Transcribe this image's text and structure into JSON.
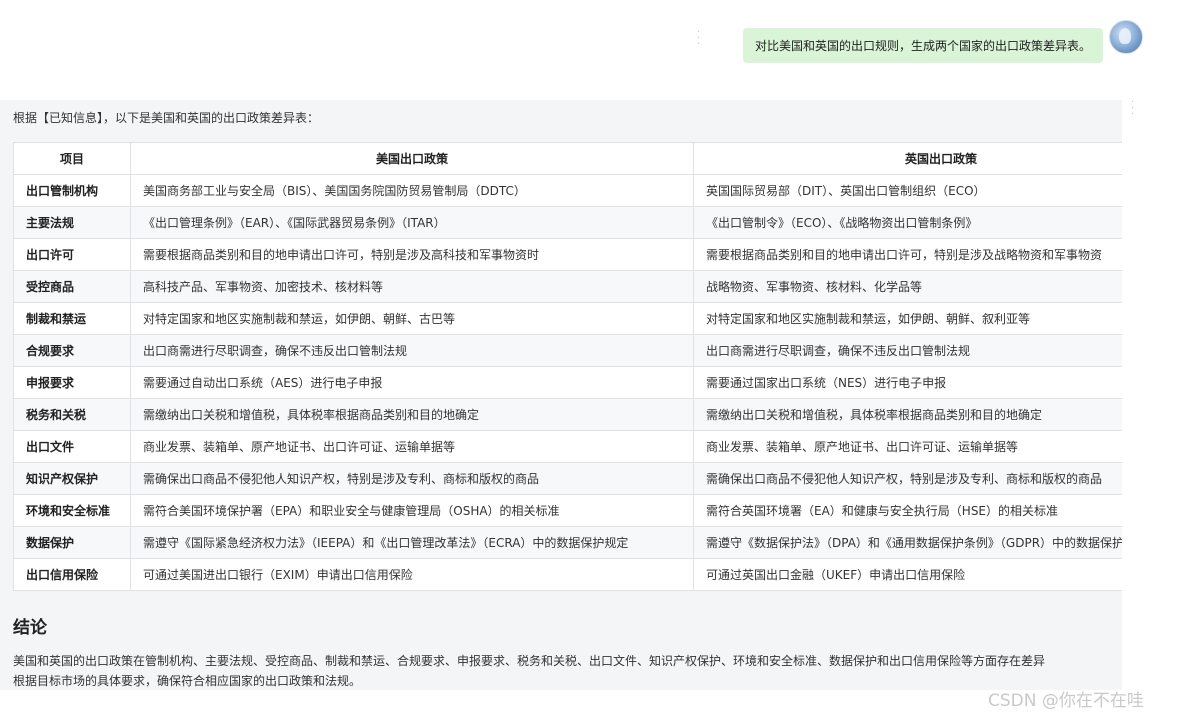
{
  "user_message": {
    "text": "对比美国和英国的出口规则，生成两个国家的出口政策差异表。"
  },
  "assistant": {
    "intro": "根据【已知信息】，以下是美国和英国的出口政策差异表：",
    "table": {
      "headers": [
        "项目",
        "美国出口政策",
        "英国出口政策"
      ],
      "rows": [
        [
          "出口管制机构",
          "美国商务部工业与安全局（BIS）、美国国务院国防贸易管制局（DDTC）",
          "英国国际贸易部（DIT）、英国出口管制组织（ECO）"
        ],
        [
          "主要法规",
          "《出口管理条例》（EAR）、《国际武器贸易条例》（ITAR）",
          "《出口管制令》（ECO）、《战略物资出口管制条例》"
        ],
        [
          "出口许可",
          "需要根据商品类别和目的地申请出口许可，特别是涉及高科技和军事物资时",
          "需要根据商品类别和目的地申请出口许可，特别是涉及战略物资和军事物资"
        ],
        [
          "受控商品",
          "高科技产品、军事物资、加密技术、核材料等",
          "战略物资、军事物资、核材料、化学品等"
        ],
        [
          "制裁和禁运",
          "对特定国家和地区实施制裁和禁运，如伊朗、朝鲜、古巴等",
          "对特定国家和地区实施制裁和禁运，如伊朗、朝鲜、叙利亚等"
        ],
        [
          "合规要求",
          "出口商需进行尽职调查，确保不违反出口管制法规",
          "出口商需进行尽职调查，确保不违反出口管制法规"
        ],
        [
          "申报要求",
          "需要通过自动出口系统（AES）进行电子申报",
          "需要通过国家出口系统（NES）进行电子申报"
        ],
        [
          "税务和关税",
          "需缴纳出口关税和增值税，具体税率根据商品类别和目的地确定",
          "需缴纳出口关税和增值税，具体税率根据商品类别和目的地确定"
        ],
        [
          "出口文件",
          "商业发票、装箱单、原产地证书、出口许可证、运输单据等",
          "商业发票、装箱单、原产地证书、出口许可证、运输单据等"
        ],
        [
          "知识产权保护",
          "需确保出口商品不侵犯他人知识产权，特别是涉及专利、商标和版权的商品",
          "需确保出口商品不侵犯他人知识产权，特别是涉及专利、商标和版权的商品"
        ],
        [
          "环境和安全标准",
          "需符合美国环境保护署（EPA）和职业安全与健康管理局（OSHA）的相关标准",
          "需符合英国环境署（EA）和健康与安全执行局（HSE）的相关标准"
        ],
        [
          "数据保护",
          "需遵守《国际紧急经济权力法》（IEEPA）和《出口管理改革法》（ECRA）中的数据保护规定",
          "需遵守《数据保护法》（DPA）和《通用数据保护条例》（GDPR）中的数据保护规定"
        ],
        [
          "出口信用保险",
          "可通过美国进出口银行（EXIM）申请出口信用保险",
          "可通过英国出口金融（UKEF）申请出口信用保险"
        ]
      ]
    },
    "conclusion": {
      "title": "结论",
      "line1": "美国和英国的出口政策在管制机构、主要法规、受控商品、制裁和禁运、合规要求、申报要求、税务和关税、出口文件、知识产权保护、环境和安全标准、数据保护和出口信用保险等方面存在差异",
      "line2": "根据目标市场的具体要求，确保符合相应国家的出口政策和法规。"
    }
  },
  "watermark": "CSDN @你在不在哇",
  "colors": {
    "user_bubble": "#d9f4d6",
    "assistant_bg": "#f4f5f7",
    "table_border": "#dfe2e5",
    "row_alt": "#f6f8fa"
  },
  "icons": {
    "avatar": "user-avatar-icon",
    "more": "more-dots-icon"
  }
}
